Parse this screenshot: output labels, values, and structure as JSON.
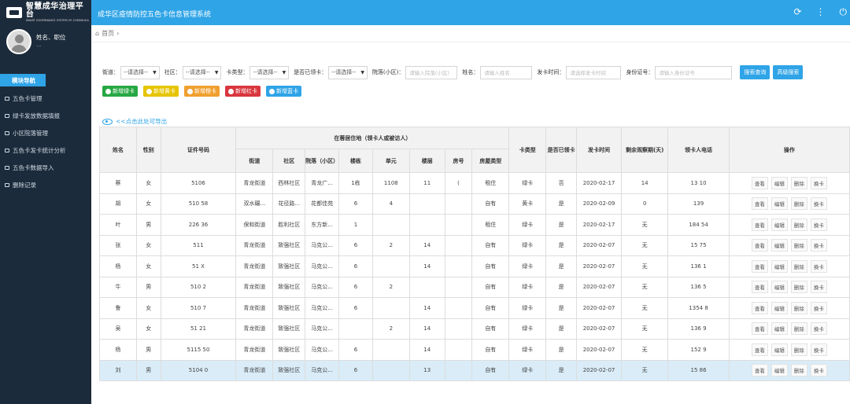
{
  "logo": {
    "name": "智慧成华治理平台",
    "en": "SMART GOVERNANCE SYSTEM OF CHENGHUA"
  },
  "system_title": "成华区疫情防控五色卡信息管理系统",
  "user": {
    "name": "姓名、职位",
    "sub": "..."
  },
  "sidebar": {
    "module_label": "模块导航",
    "items": [
      {
        "label": "五色卡管理"
      },
      {
        "label": "绿卡发放数据填报"
      },
      {
        "label": "小区院落管理"
      },
      {
        "label": "五色卡发卡统计分析"
      },
      {
        "label": "五色卡数据导入"
      },
      {
        "label": "删除记录"
      }
    ]
  },
  "breadcrumb": {
    "home": "首页"
  },
  "filters": {
    "street_label": "街道：",
    "street_value": "--请选择--",
    "community_label": "社区：",
    "community_value": "--请选择--",
    "cardtype_label": "卡类型：",
    "cardtype_value": "--请选择--",
    "received_label": "是否已领卡：",
    "received_value": "--请选择--",
    "yard_label": "院落(小区)：",
    "yard_placeholder": "请输入院落(小区)",
    "name_label": "姓名：",
    "name_placeholder": "请输入姓名",
    "issue_label": "发卡时间：",
    "issue_placeholder": "请选择发卡时间",
    "id_label": "身份证号：",
    "id_placeholder": "请输入身份证号",
    "search_label": "搜索查询",
    "advanced_label": "高级搜索"
  },
  "add_buttons": [
    {
      "label": "新增绿卡",
      "color": "#27a844"
    },
    {
      "label": "新增黄卡",
      "color": "#e6c400"
    },
    {
      "label": "新增橙卡",
      "color": "#f0a030"
    },
    {
      "label": "新增红卡",
      "color": "#d9363e"
    },
    {
      "label": "新增蓝卡",
      "color": "#2fa4e7"
    }
  ],
  "export_label": "<<点击此处可导出",
  "table": {
    "h_name": "姓名",
    "h_gender": "性别",
    "h_id": "证件号码",
    "h_residence": "在蓉居住地（领卡人或被访人）",
    "h_street": "街道",
    "h_community": "社区",
    "h_yard": "院落（小区）",
    "h_building": "楼栋",
    "h_unit": "单元",
    "h_floor": "楼层",
    "h_room": "房号",
    "h_housetype": "房屋类型",
    "h_cardtype": "卡类型",
    "h_received": "是否已领卡",
    "h_issued": "发卡时间",
    "h_remaining": "剩余观察期(天)",
    "h_phone": "领卡人电话",
    "h_ops": "操作",
    "op_view": "查看",
    "op_edit": "编辑",
    "op_delete": "删除",
    "op_change": "换卡",
    "rows": [
      {
        "name": "蔡",
        "gender": "女",
        "id": "5106",
        "street": "青龙街道",
        "community": "西林社区",
        "yard": "青龙广...",
        "building": "1栋",
        "unit": "1108",
        "floor": "11",
        "room": "(",
        "housetype": "租住",
        "card": "绿卡",
        "received": "否",
        "issued": "2020-02-17",
        "remaining": "14",
        "phone": "13            10"
      },
      {
        "name": "胡",
        "gender": "女",
        "id": "510            58",
        "street": "双水碾...",
        "community": "花径路...",
        "yard": "花都佳苑",
        "building": "6",
        "unit": "4",
        "floor": "",
        "room": "",
        "housetype": "自有",
        "card": "黄卡",
        "received": "是",
        "issued": "2020-02-09",
        "remaining": "0",
        "phone": "139"
      },
      {
        "name": "叶",
        "gender": "男",
        "id": "226            36",
        "street": "保和街道",
        "community": "胜利社区",
        "yard": "东方新...",
        "building": "1",
        "unit": "",
        "floor": "",
        "room": "",
        "housetype": "租住",
        "card": "绿卡",
        "received": "是",
        "issued": "2020-02-17",
        "remaining": "无",
        "phone": "184            54"
      },
      {
        "name": "张",
        "gender": "女",
        "id": "511",
        "street": "青龙街道",
        "community": "致强社区",
        "yard": "马克公...",
        "building": "6",
        "unit": "2",
        "floor": "14",
        "room": "",
        "housetype": "自有",
        "card": "绿卡",
        "received": "是",
        "issued": "2020-02-07",
        "remaining": "无",
        "phone": "15            75"
      },
      {
        "name": "杨",
        "gender": "女",
        "id": "51            X",
        "street": "青龙街道",
        "community": "致强社区",
        "yard": "马克公...",
        "building": "6",
        "unit": "",
        "floor": "14",
        "room": "",
        "housetype": "自有",
        "card": "绿卡",
        "received": "是",
        "issued": "2020-02-07",
        "remaining": "无",
        "phone": "136            1"
      },
      {
        "name": "牛",
        "gender": "男",
        "id": "510            2",
        "street": "青龙街道",
        "community": "致强社区",
        "yard": "马克公...",
        "building": "6",
        "unit": "2",
        "floor": "",
        "room": "",
        "housetype": "自有",
        "card": "绿卡",
        "received": "是",
        "issued": "2020-02-07",
        "remaining": "无",
        "phone": "136            5"
      },
      {
        "name": "鲁",
        "gender": "女",
        "id": "510            7",
        "street": "青龙街道",
        "community": "致强社区",
        "yard": "马克公...",
        "building": "6",
        "unit": "",
        "floor": "14",
        "room": "",
        "housetype": "自有",
        "card": "绿卡",
        "received": "是",
        "issued": "2020-02-07",
        "remaining": "无",
        "phone": "1354            8"
      },
      {
        "name": "吴",
        "gender": "女",
        "id": "51            21",
        "street": "青龙街道",
        "community": "致强社区",
        "yard": "马克公...",
        "building": "",
        "unit": "2",
        "floor": "14",
        "room": "",
        "housetype": "自有",
        "card": "绿卡",
        "received": "是",
        "issued": "2020-02-07",
        "remaining": "无",
        "phone": "136            9"
      },
      {
        "name": "杨",
        "gender": "男",
        "id": "5115            50",
        "street": "青龙街道",
        "community": "致强社区",
        "yard": "马克公...",
        "building": "6",
        "unit": "",
        "floor": "14",
        "room": "",
        "housetype": "自有",
        "card": "绿卡",
        "received": "是",
        "issued": "2020-02-07",
        "remaining": "无",
        "phone": "152            9"
      },
      {
        "name": "刘",
        "gender": "男",
        "id": "5104            0",
        "street": "青龙街道",
        "community": "致强社区",
        "yard": "马克公...",
        "building": "6",
        "unit": "",
        "floor": "13",
        "room": "",
        "housetype": "自有",
        "card": "绿卡",
        "received": "是",
        "issued": "2020-02-07",
        "remaining": "无",
        "phone": "15            86"
      }
    ]
  }
}
